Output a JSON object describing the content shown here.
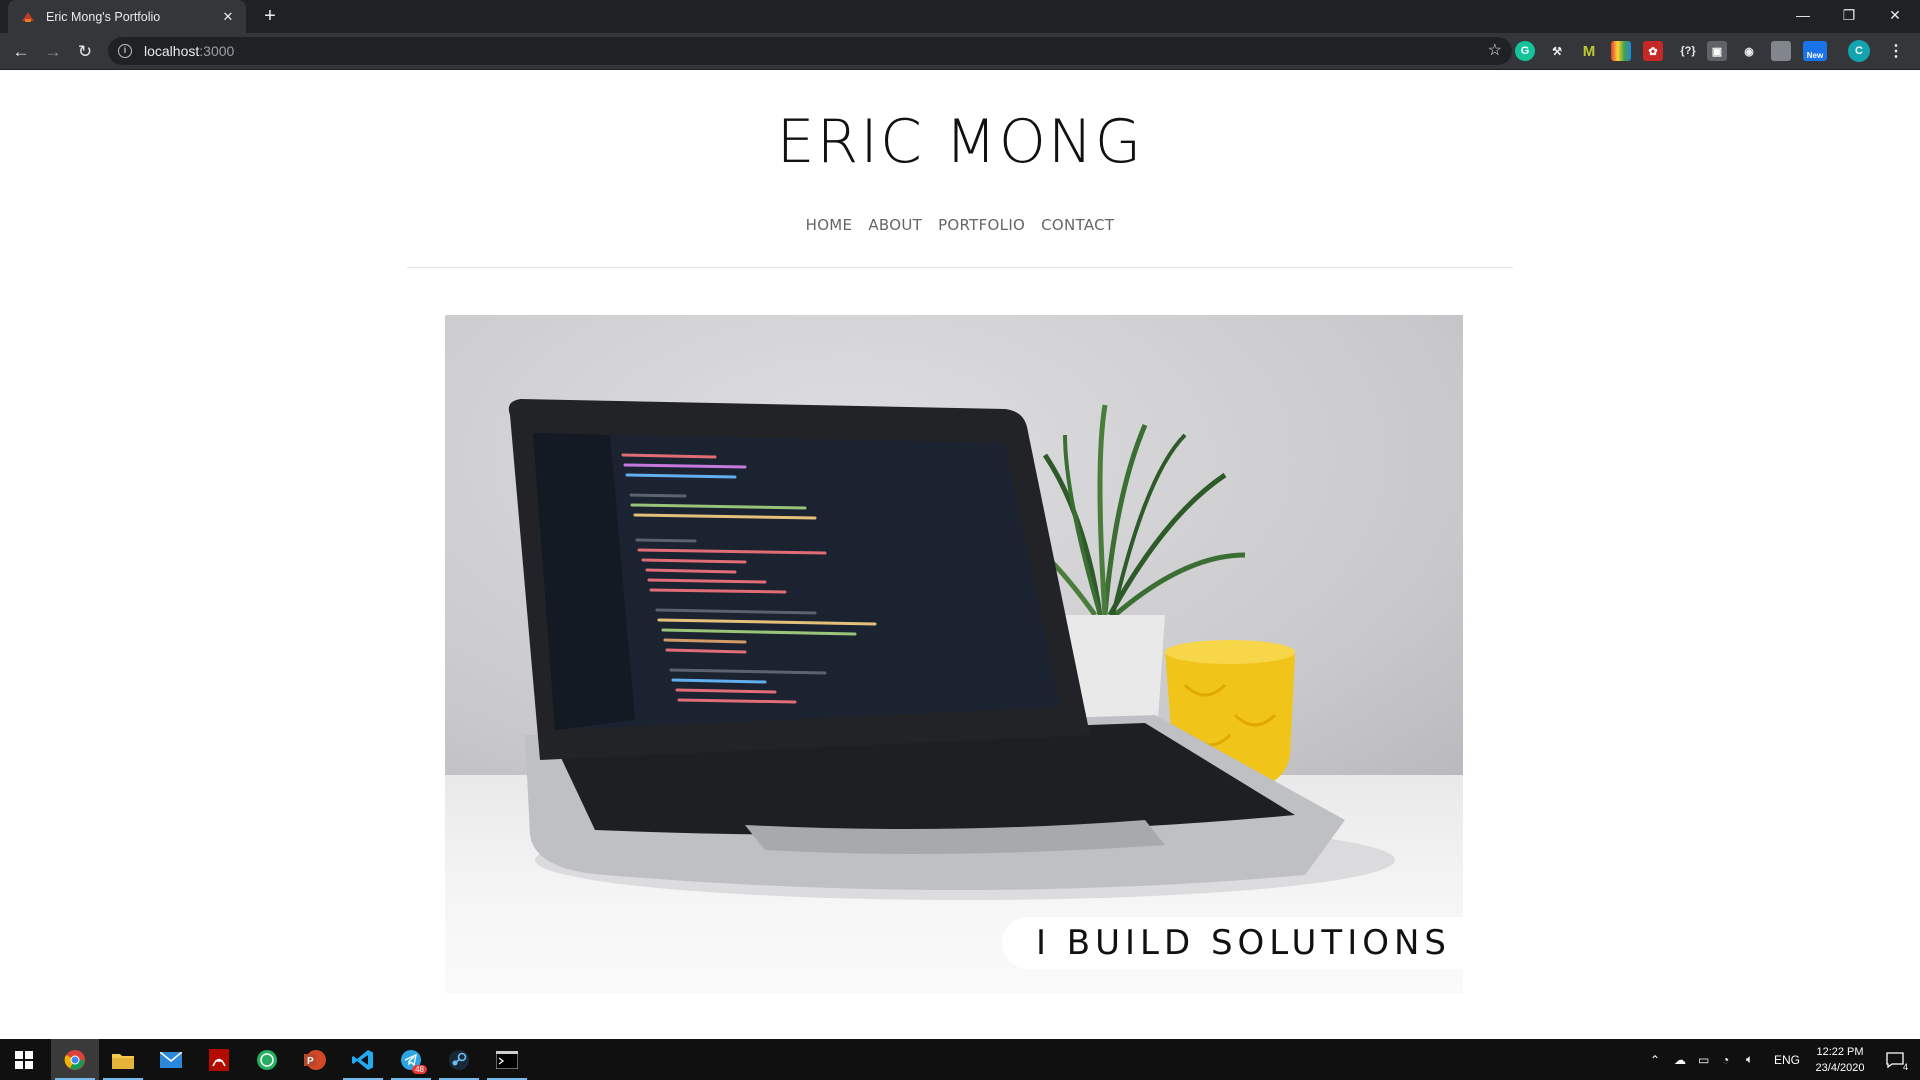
{
  "browser": {
    "tab_title": "Eric Mong's Portfolio",
    "tab_close": "✕",
    "new_tab": "+",
    "url_host": "localhost",
    "url_port": ":3000",
    "window_controls": {
      "minimize": "—",
      "restore": "❐",
      "close": "✕"
    },
    "extensions": [
      {
        "name": "grammarly-icon",
        "label": "G",
        "color": "#15c39a"
      },
      {
        "name": "tool-icon",
        "label": "⚒",
        "color": "#5f6368"
      },
      {
        "name": "m-extension-icon",
        "label": "M",
        "color": "#7cb342"
      },
      {
        "name": "palette-icon",
        "label": "▦",
        "color": "#e53935"
      },
      {
        "name": "red-extension-icon",
        "label": "✿",
        "color": "#c62828"
      },
      {
        "name": "json-extension-icon",
        "label": "{?}",
        "color": "#35363a"
      },
      {
        "name": "box-extension-icon",
        "label": "▣",
        "color": "#5f6368"
      },
      {
        "name": "camera-icon",
        "label": "◉",
        "color": "#5f6368"
      },
      {
        "name": "gray-extension-icon",
        "label": "▢",
        "color": "#80868b"
      },
      {
        "name": "new-extension-icon",
        "label": "New",
        "color": "#1a73e8"
      }
    ],
    "profile_initial": "C"
  },
  "site": {
    "title": "ERIC MONG",
    "nav": [
      {
        "label": "HOME"
      },
      {
        "label": "ABOUT"
      },
      {
        "label": "PORTFOLIO"
      },
      {
        "label": "CONTACT"
      }
    ],
    "hero_tagline": "I BUILD SOLUTIONS"
  },
  "taskbar": {
    "apps": [
      {
        "name": "chrome-icon",
        "color": "#fbbc05",
        "active": true
      },
      {
        "name": "file-explorer-icon",
        "color": "#f2c94c",
        "active": false
      },
      {
        "name": "mail-icon",
        "color": "#2b88d8",
        "active": false
      },
      {
        "name": "acrobat-icon",
        "color": "#e02020",
        "active": false
      },
      {
        "name": "green-app-icon",
        "color": "#27ae60",
        "active": false
      },
      {
        "name": "powerpoint-icon",
        "color": "#d24726",
        "active": false
      },
      {
        "name": "vscode-icon",
        "color": "#23a9f2",
        "active": false
      },
      {
        "name": "telegram-icon",
        "color": "#2ca5e0",
        "active": false
      },
      {
        "name": "steam-icon",
        "color": "#3d7cb5",
        "active": false
      },
      {
        "name": "terminal-icon",
        "color": "#cccccc",
        "active": false
      }
    ],
    "telegram_badge": "48",
    "language": "ENG",
    "time": "12:22 PM",
    "date": "23/4/2020",
    "notification_count": "4"
  }
}
